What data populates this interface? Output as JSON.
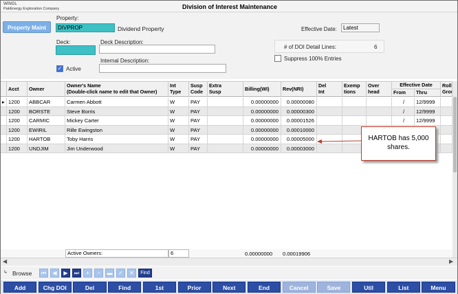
{
  "app": {
    "name": "WINGL",
    "company": "PakEnergy Exploration Company",
    "title": "Division of Interest Maintenance"
  },
  "form": {
    "property_maint_button": "Property Maint",
    "property_label": "Property:",
    "property_value": "DIVPROP",
    "property_name": "Dividend Property",
    "deck_label": "Deck:",
    "deck_value": "",
    "deck_description_label": "Deck Description:",
    "deck_description_value": "",
    "internal_description_label": "Internal Description:",
    "internal_description_value": "",
    "active_label": "Active",
    "active_checked": true,
    "effective_date_label": "Effective Date:",
    "effective_date_value": "Latest",
    "doi_lines_label": "# of DOI Detail Lines:",
    "doi_lines_value": "6",
    "suppress_label": "Suppress 100% Entries",
    "suppress_checked": false
  },
  "grid": {
    "headers": {
      "acct": "Acct",
      "owner": "Owner",
      "owner_name": "Owner's Name\n(Double-click name to edit that Owner)",
      "int_type": "Int\nType",
      "susp_code": "Susp\nCode",
      "extra_susp": "Extra\nSusp",
      "billing": "Billing(WI)",
      "rev": "Rev(NRI)",
      "del_int": "Del\nInt",
      "exemptions": "Exemp\ntions",
      "overhead": "Over\nhead",
      "effective_date": "Effective Date",
      "from": "From",
      "thru": "Thru",
      "roll_group": "Roll\nGrou"
    },
    "rows": [
      {
        "acct": "1200",
        "owner": "ABBCAR",
        "name": "Carmen Abbott",
        "int_type": "W",
        "susp": "PAY",
        "billing": "0.00000000",
        "rev": "0.00000080",
        "from": "/",
        "thru": "12/9999"
      },
      {
        "acct": "1200",
        "owner": "BORSTE",
        "name": "Steve Borris",
        "int_type": "W",
        "susp": "PAY",
        "billing": "0.00000000",
        "rev": "0.00000300",
        "from": "/",
        "thru": "12/9999"
      },
      {
        "acct": "1200",
        "owner": "CARMIC",
        "name": "Mickey Carter",
        "int_type": "W",
        "susp": "PAY",
        "billing": "0.00000000",
        "rev": "0.00001526",
        "from": "/",
        "thru": "12/9999"
      },
      {
        "acct": "1200",
        "owner": "EWIRIL",
        "name": "Rille Ewingston",
        "int_type": "W",
        "susp": "PAY",
        "billing": "0.00000000",
        "rev": "0.00010000",
        "from": "",
        "thru": ""
      },
      {
        "acct": "1200",
        "owner": "HARTOB",
        "name": "Toby Harris",
        "int_type": "W",
        "susp": "PAY",
        "billing": "0.00000000",
        "rev": "0.00005000",
        "from": "",
        "thru": ""
      },
      {
        "acct": "1200",
        "owner": "UNDJIM",
        "name": "Jim Underwood",
        "int_type": "W",
        "susp": "PAY",
        "billing": "0.00000000",
        "rev": "0.00003000",
        "from": "",
        "thru": ""
      }
    ]
  },
  "totals": {
    "active_owners_label": "Active Owners:",
    "active_owners_value": "6",
    "billing_total": "0.00000000",
    "rev_total": "0.00019906"
  },
  "callout": {
    "text": "HARTOB has 5,000 shares."
  },
  "browse": {
    "label": "Browse",
    "find_label": "Find"
  },
  "commands": [
    "Add",
    "Chg DOI",
    "Del",
    "Find",
    "1st",
    "Prior",
    "Next",
    "End",
    "Cancel",
    "Save",
    "Util",
    "List",
    "Menu"
  ],
  "colors": {
    "command_blue": "#2c4ea5",
    "property_field": "#3ec0c4",
    "callout_border": "#c0392b",
    "arrow": "#c0392b"
  }
}
